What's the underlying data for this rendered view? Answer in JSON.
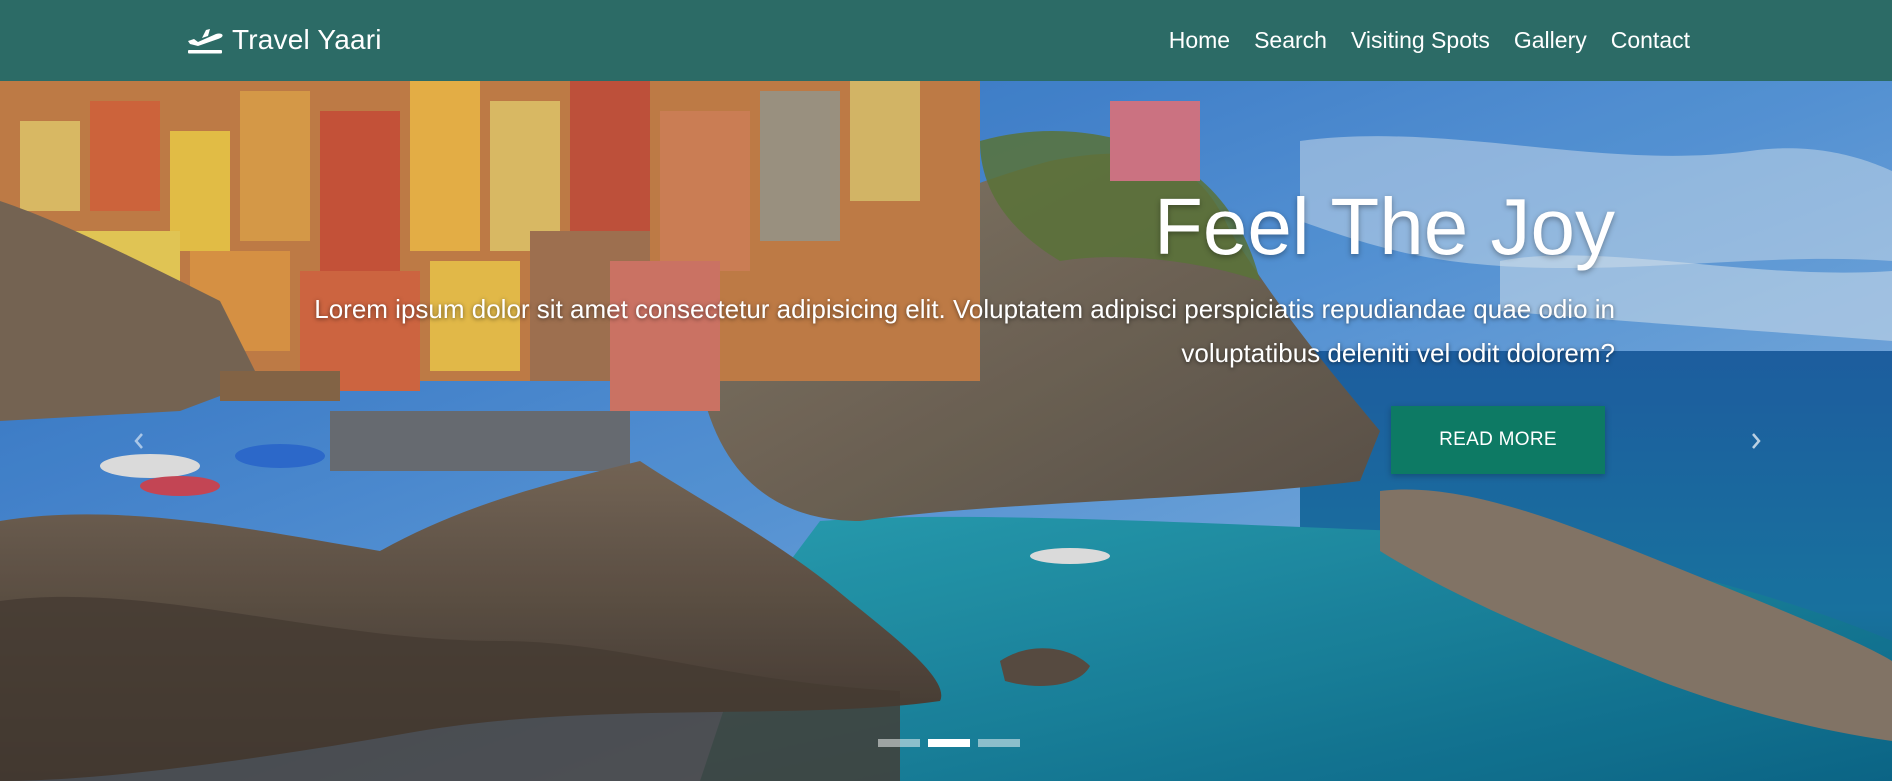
{
  "navbar": {
    "brand": {
      "icon": "airplane-departure-icon",
      "text": "Travel Yaari"
    },
    "links": [
      "Home",
      "Search",
      "Visiting Spots",
      "Gallery",
      "Contact"
    ]
  },
  "hero": {
    "image": "coastal-cliff-village-photo",
    "title": "Feel The Joy",
    "text": "Lorem ipsum dolor sit amet consectetur adipisicing elit. Voluptatem adipisci perspiciatis repudiandae quae odio in voluptatibus deleniti vel odit dolorem?",
    "button_label": "READ MORE",
    "prev_icon": "chevron-left-icon",
    "next_icon": "chevron-right-icon",
    "slides_count": 3,
    "active_slide": 2
  },
  "colors": {
    "navbar_bg": "#2c6b66",
    "button_bg": "#0d7a64",
    "text": "#ffffff"
  }
}
